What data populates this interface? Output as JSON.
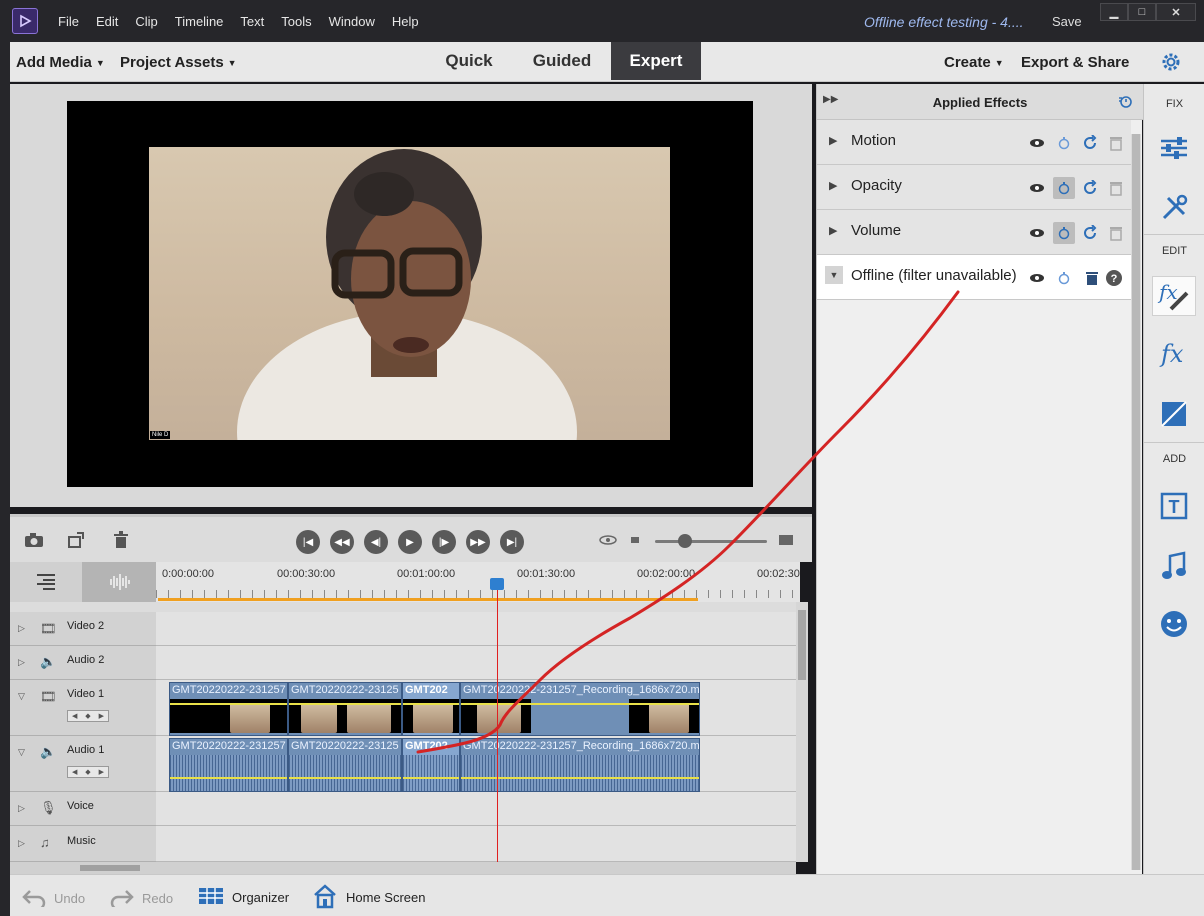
{
  "menu": [
    "File",
    "Edit",
    "Clip",
    "Timeline",
    "Text",
    "Tools",
    "Window",
    "Help"
  ],
  "window": {
    "doc_title": "Offline effect testing - 4....",
    "save": "Save"
  },
  "toolbar": {
    "add_media": "Add Media",
    "project_assets": "Project Assets",
    "modes": [
      "Quick",
      "Guided",
      "Expert"
    ],
    "active_mode": "Expert",
    "create": "Create",
    "export_share": "Export & Share"
  },
  "monitor": {
    "name_tag": "Nile D"
  },
  "timeline": {
    "ruler": [
      "0:00:00:00",
      "00:00:30:00",
      "00:01:00:00",
      "00:01:30:00",
      "00:02:00:00",
      "00:02:30"
    ],
    "tracks": [
      "Video 2",
      "Audio 2",
      "Video 1",
      "Audio 1",
      "Voice",
      "Music"
    ],
    "video_clips": [
      "GMT20220222-231257",
      "GMT20220222-23125",
      "GMT202",
      "GMT20220222-231257_Recording_1686x720.m"
    ],
    "audio_clips": [
      "GMT20220222-231257",
      "GMT20220222-23125",
      "GMT202",
      "GMT20220222-231257_Recording_1686x720.m"
    ]
  },
  "bottom": {
    "undo": "Undo",
    "redo": "Redo",
    "organizer": "Organizer",
    "home": "Home Screen"
  },
  "effects_panel": {
    "title": "Applied Effects",
    "effects": [
      {
        "name": "Motion",
        "expanded": false
      },
      {
        "name": "Opacity",
        "expanded": false
      },
      {
        "name": "Volume",
        "expanded": false
      },
      {
        "name": "Offline (filter unavailable)",
        "expanded": true
      }
    ]
  },
  "sidebar": {
    "fix": "FIX",
    "edit": "EDIT",
    "add": "ADD"
  },
  "colors": {
    "accent": "#2e7fd0",
    "clip": "#6f8fb6",
    "playhead": "#e02020",
    "annotation": "#d42424",
    "title_link": "#9fb9ef"
  }
}
